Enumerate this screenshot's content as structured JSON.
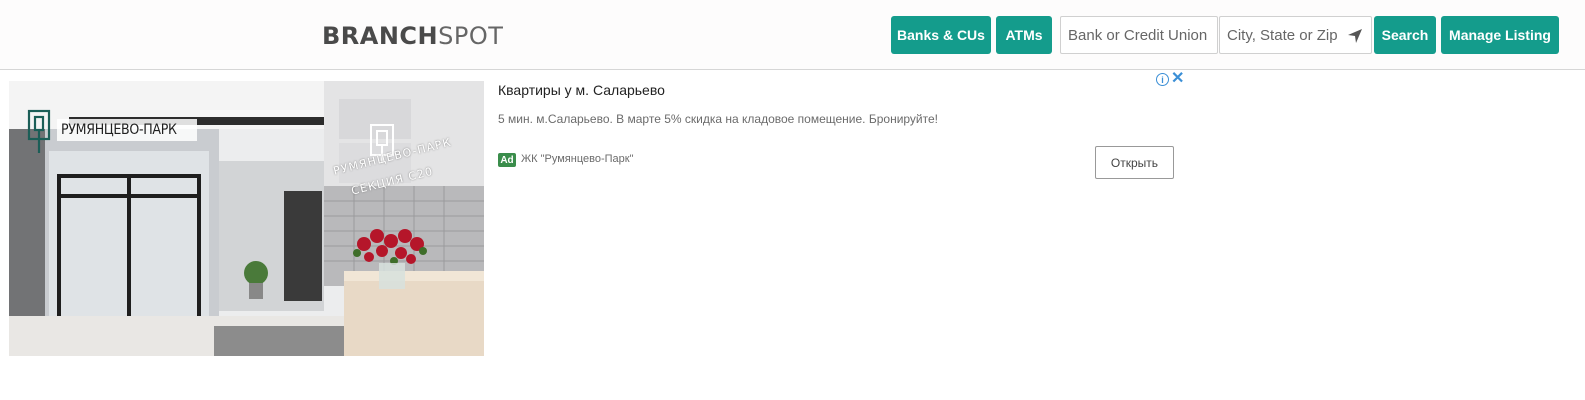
{
  "header": {
    "logo_bold": "BRANCH",
    "logo_light": "SPOT",
    "nav": {
      "banks_label": "Banks & CUs",
      "atms_label": "ATMs"
    },
    "search": {
      "bank_placeholder": "Bank or Credit Union",
      "city_placeholder": "City, State or Zip",
      "search_label": "Search"
    },
    "manage_label": "Manage Listing",
    "colors": {
      "accent": "#149c8c"
    }
  },
  "ad": {
    "image_brand_text": "РУМЯНЦЕВО-ПАРК",
    "image_sign_line1": "РУМЯНЦЕВО-ПАРК",
    "image_sign_line2": "СЕКЦИЯ С20",
    "title": "Квартиры у м. Саларьево",
    "description": "5 мин. м.Саларьево. В марте 5% скидка на кладовое помещение. Бронируйте!",
    "badge": "Ad",
    "advertiser": "ЖК \"Румянцево-Парк\"",
    "open_label": "Открыть",
    "info_icon": "info-icon",
    "close_icon": "close-icon"
  }
}
